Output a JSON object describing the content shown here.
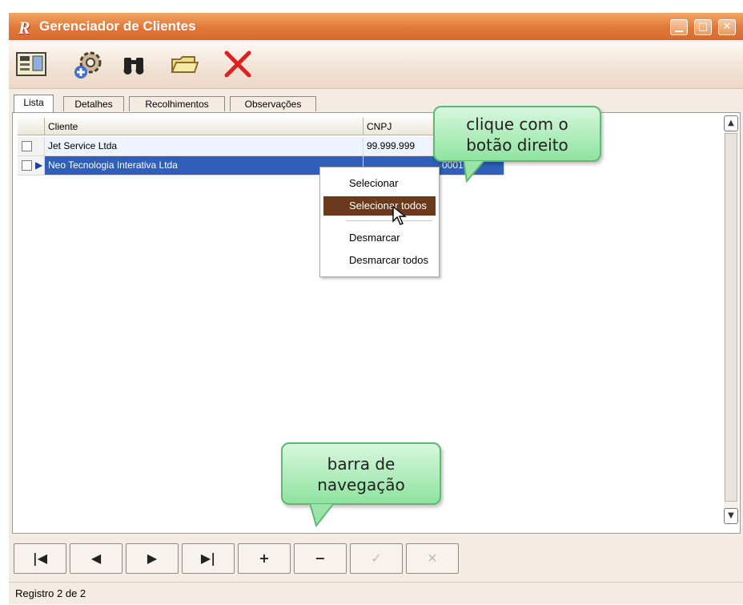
{
  "window": {
    "title": "Gerenciador de Clientes",
    "logo": "R",
    "controls": [
      "minimize-icon",
      "maximize-icon",
      "close-icon"
    ],
    "accent_color": "#e0783a"
  },
  "toolbar": {
    "buttons": [
      "form-view-icon",
      "settings-add-icon",
      "binoculars-search-icon",
      "open-folder-icon",
      "delete-x-icon"
    ]
  },
  "tabs": [
    {
      "label": "Lista",
      "active": true
    },
    {
      "label": "Detalhes"
    },
    {
      "label": "Recolhimentos"
    },
    {
      "label": "Observações"
    }
  ],
  "grid": {
    "columns": [
      "Cliente",
      "CNPJ"
    ],
    "rows": [
      {
        "cliente": "Jet Service Ltda",
        "cnpj": "99.999.999"
      },
      {
        "cliente": "Neo Tecnologia Interativa Ltda",
        "cnpj": "0001-14",
        "selected": true
      }
    ]
  },
  "context_menu": {
    "items": [
      "Selecionar",
      "Selecionar todos",
      "Desmarcar",
      "Desmarcar todos"
    ],
    "highlighted_index": 1
  },
  "callouts": {
    "right_click": "clique com o botão direito",
    "nav_bar": "barra de navegação"
  },
  "navigator": {
    "buttons": [
      {
        "label": "|◀",
        "name": "first-record"
      },
      {
        "label": "◀",
        "name": "prior-record"
      },
      {
        "label": "▶",
        "name": "next-record"
      },
      {
        "label": "▶|",
        "name": "last-record"
      },
      {
        "label": "+",
        "name": "insert-record"
      },
      {
        "label": "−",
        "name": "delete-record"
      },
      {
        "label": "✓",
        "name": "post-record",
        "disabled": true
      },
      {
        "label": "✕",
        "name": "cancel-record",
        "disabled": true
      }
    ]
  },
  "status": {
    "text": "Registro 2 de 2"
  },
  "colors": {
    "selected_row": "#2f5fb8",
    "menu_highlight": "#6b3a1c",
    "callout": "#8fe3a0"
  }
}
